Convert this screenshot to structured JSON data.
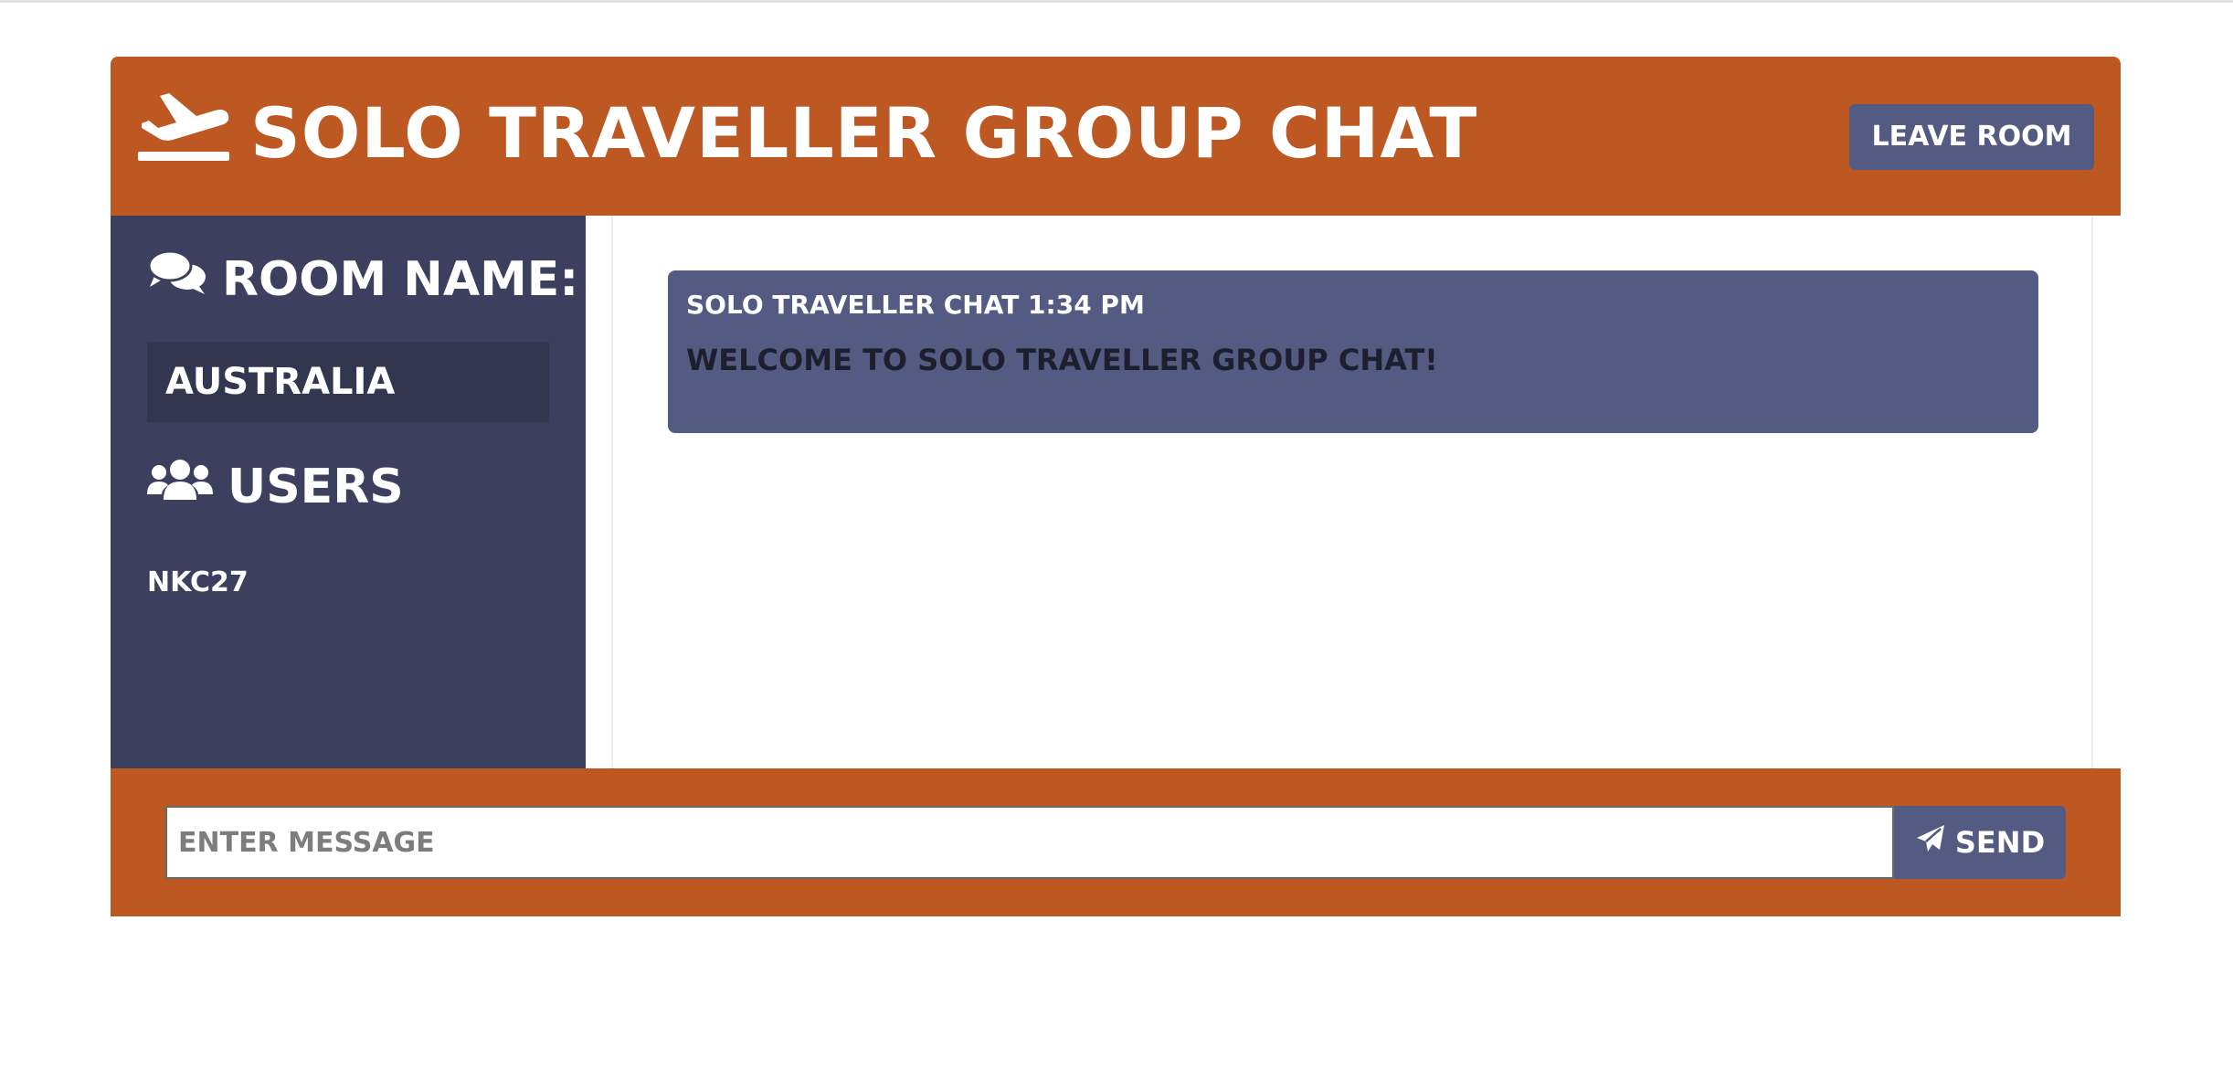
{
  "header": {
    "icon": "plane-departure-icon",
    "title": "Solo Traveller Group Chat",
    "leave_button_label": "Leave Room"
  },
  "sidebar": {
    "room_heading": "Room Name:",
    "room_heading_icon": "comments-icon",
    "room_name": "Australia",
    "users_heading": "Users",
    "users_heading_icon": "users-icon",
    "users": [
      "NKC27"
    ]
  },
  "messages": [
    {
      "meta": "Solo Traveller Chat 1:34 PM",
      "text": "Welcome to Solo Traveller Group Chat!"
    }
  ],
  "chat_form": {
    "input_placeholder": "Enter Message",
    "input_value": "",
    "send_label": "Send",
    "send_icon": "paper-plane-icon"
  },
  "colors": {
    "brand_orange": "#bd5822",
    "sidebar_bg": "#3c3f5d",
    "room_box_bg": "#33364f",
    "accent_purple": "#545b82"
  }
}
